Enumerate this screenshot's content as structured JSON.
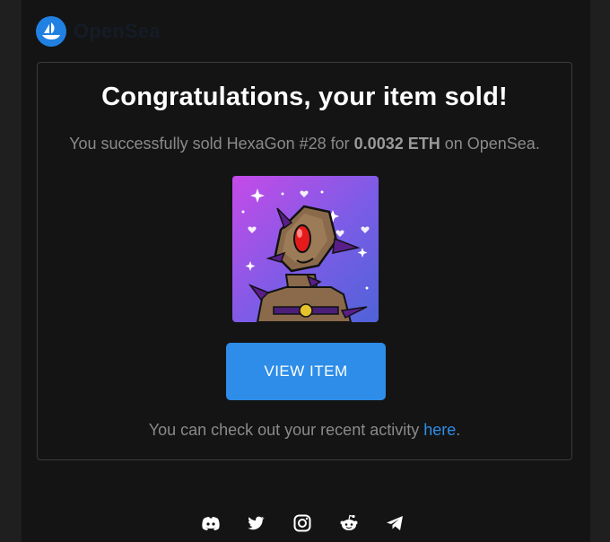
{
  "brand": {
    "name": "OpenSea",
    "color": "#2081e2",
    "logo_icon": "sailboat-icon"
  },
  "email": {
    "title": "Congratulations, your item sold!",
    "subtitle_prefix": "You successfully sold HexaGon #28 for ",
    "price": "0.0032 ETH",
    "subtitle_suffix": " on OpenSea.",
    "button_label": "VIEW ITEM",
    "footer_prefix": "You can check out your recent activity ",
    "footer_link": "here",
    "footer_suffix": "."
  },
  "nft_image": {
    "icon": "hexagon-robot-nft-image"
  },
  "social_icons": [
    "discord-icon",
    "twitter-icon",
    "instagram-icon",
    "reddit-icon",
    "telegram-icon"
  ],
  "colors": {
    "accent": "#2d8de8",
    "background": "#141414",
    "card_border": "#3b3b3b"
  }
}
